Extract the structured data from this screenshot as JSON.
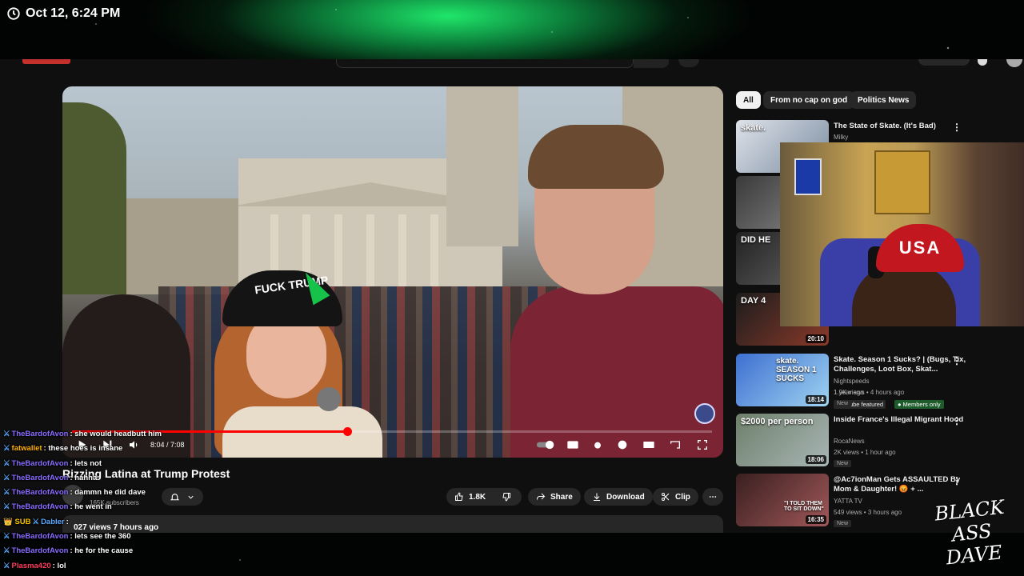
{
  "overlay": {
    "clock_text": "Oct 12, 6:24 PM",
    "signature_text": "BLACK ASS DAVE"
  },
  "youtube": {
    "video": {
      "title": "Rizzing Latina at Trump Protest",
      "time_display": "8:04 / 7:08",
      "progress_fraction": 0.43,
      "cap_text": "FUCK TRUMP",
      "channel_subscribers": "165K subscribers",
      "views": "027 views  7 hours ago",
      "like_count": "1.8K",
      "share_label": "Share",
      "download_label": "Download",
      "clip_label": "Clip",
      "more_label": "⋯"
    },
    "chips": [
      "All",
      "From no cap on god",
      "Politics News"
    ],
    "recommendations": [
      {
        "title": "The State of Skate. (It's Bad)",
        "channel": "Milky",
        "thumb_text": "skate.",
        "duration": ""
      },
      {
        "title": "",
        "channel": "",
        "thumb_text": "",
        "duration": ""
      },
      {
        "title": "",
        "channel": "",
        "thumb_text": "DID HE",
        "duration": ""
      },
      {
        "title": "",
        "channel": "",
        "thumb_text": "DAY 4",
        "duration": "20:10",
        "ago": "1 year ago",
        "badge1": "YouTube featured",
        "badge2": "Members only"
      },
      {
        "title": "Skate. Season 1 Sucks? | (Bugs, Tix, Challenges, Loot Box, Skat...",
        "channel": "Nightspeeds",
        "meta": "1.9K views • 4 hours ago",
        "new": "New",
        "thumb_text": "skate. SEASON 1 SUCKS",
        "duration": "18:14"
      },
      {
        "title": "Inside France's Illegal Migrant Hood",
        "channel": "RocaNews",
        "meta": "2K views • 1 hour ago",
        "new": "New",
        "thumb_text": "$2000 per person",
        "duration": "18:06"
      },
      {
        "title": "@Ac7ionMan Gets ASSAULTED By Mom & Daughter! 😡 + ...",
        "channel": "YATTA TV",
        "meta": "549 views • 3 hours ago",
        "new": "New",
        "thumb_text": "\"I TOLD THEM TO SIT DOWN\"",
        "duration": "16:35"
      }
    ]
  },
  "chat": [
    {
      "user": "TheBardofAvon",
      "color": "#8a6bff",
      "msg": "she would headbutt him",
      "badge": ""
    },
    {
      "user": "fatwallet",
      "color": "#ffb000",
      "msg": "these hoes is insane",
      "badge": ""
    },
    {
      "user": "TheBardofAvon",
      "color": "#8a6bff",
      "msg": "lets not",
      "badge": ""
    },
    {
      "user": "TheBardofAvon",
      "color": "#8a6bff",
      "msg": "hahha",
      "badge": ""
    },
    {
      "user": "TheBardofAvon",
      "color": "#8a6bff",
      "msg": "dammn he did dave",
      "badge": ""
    },
    {
      "user": "TheBardofAvon",
      "color": "#8a6bff",
      "msg": "he went in",
      "badge": ""
    },
    {
      "user": "Dabler",
      "color": "#5aa9ff",
      "msg": "",
      "badge": "👑 SUB"
    },
    {
      "user": "TheBardofAvon",
      "color": "#8a6bff",
      "msg": "lets see the 360",
      "badge": ""
    },
    {
      "user": "TheBardofAvon",
      "color": "#8a6bff",
      "msg": "he for the cause",
      "badge": ""
    },
    {
      "user": "Plasma420",
      "color": "#ff3b5c",
      "msg": "lol",
      "badge": ""
    }
  ]
}
